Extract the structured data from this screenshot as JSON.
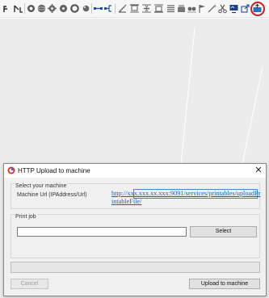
{
  "dialog": {
    "title": "HTTP Upload to machine",
    "close_glyph": "✕",
    "machine_group_title": "Select your machine",
    "machine_url_label": "Machine Url (IPAddress/Url)",
    "machine_url_value": "http://xxx.xxx.xx.xxx:9091/services/printables/uploadPrintableFile/",
    "print_job_group_title": "Print job",
    "print_job_value": "",
    "select_button_label": "Select",
    "cancel_button_label": "Cancel",
    "upload_button_label": "Upload to machine",
    "upload_progress_fraction": 0
  },
  "toolbar": {
    "icons": [
      "move-icon",
      "select-icon",
      "circle-tool-icon",
      "sphere-icon",
      "gear-icon",
      "sprocket-icon",
      "ring-icon",
      "nodes-icon",
      "link-icon",
      "measure-icon",
      "align-top-icon",
      "align-middle-icon",
      "align-bottom-icon",
      "stack-icon",
      "eye-icon",
      "flag-icon",
      "wand-icon",
      "scissors-icon",
      "screen-icon",
      "external-link-icon",
      "upload-to-machine-icon"
    ],
    "highlighted_icon": "upload-to-machine-icon",
    "highlight_color": "#d21b1b"
  },
  "colors": {
    "link": "#1f5fb8",
    "focus_border": "#4a86c8",
    "progress": "#06b025"
  }
}
